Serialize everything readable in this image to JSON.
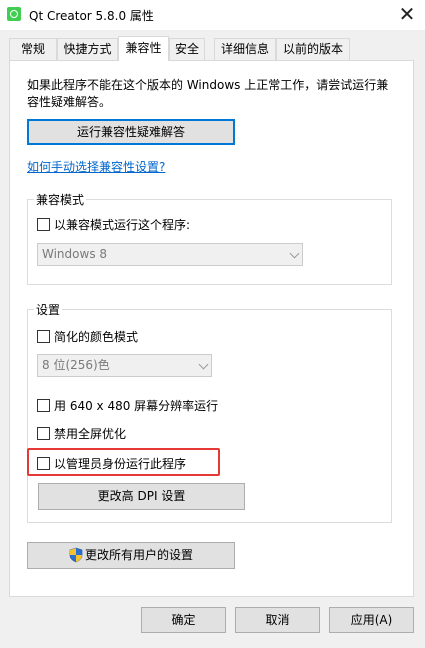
{
  "window": {
    "title": "Qt Creator  5.8.0 属性",
    "close_glyph": "✕"
  },
  "tabs": [
    {
      "label": "常规"
    },
    {
      "label": "快捷方式"
    },
    {
      "label": "兼容性"
    },
    {
      "label": "安全"
    },
    {
      "label": "详细信息"
    },
    {
      "label": "以前的版本"
    }
  ],
  "active_tab": "兼容性",
  "intro": {
    "line1": "如果此程序不能在这个版本的 Windows 上正常工作，请尝试运行兼",
    "line2": "容性疑难解答。"
  },
  "troubleshooter_button": "运行兼容性疑难解答",
  "manual_link": "如何手动选择兼容性设置?",
  "compat_mode": {
    "legend": "兼容模式",
    "checkbox_label": "以兼容模式运行这个程序:",
    "select_value": "Windows 8"
  },
  "settings": {
    "legend": "设置",
    "reduced_color_label": "简化的颜色模式",
    "color_select_value": "8 位(256)色",
    "res_640_label": "用 640 x 480 屏幕分辨率运行",
    "disable_fullscreen_label": "禁用全屏优化",
    "run_as_admin_label": "以管理员身份运行此程序",
    "dpi_button": "更改高 DPI 设置"
  },
  "all_users_button": "更改所有用户的设置",
  "footer": {
    "ok": "确定",
    "cancel": "取消",
    "apply": "应用(A)"
  },
  "colors": {
    "highlight": "#e53935",
    "link": "#0066cc",
    "focus_border": "#0078d7"
  }
}
